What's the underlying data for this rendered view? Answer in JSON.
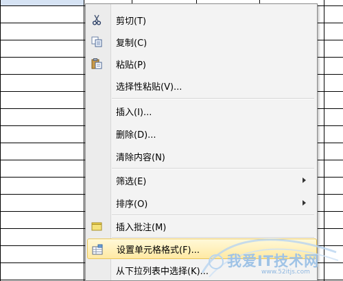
{
  "context_menu": {
    "items": [
      {
        "label": "剪切(T)",
        "icon": "scissors-icon"
      },
      {
        "label": "复制(C)",
        "icon": "copy-icon"
      },
      {
        "label": "粘贴(P)",
        "icon": "paste-icon"
      },
      {
        "label": "选择性粘贴(V)..."
      },
      {
        "label": "插入(I)..."
      },
      {
        "label": "删除(D)..."
      },
      {
        "label": "清除内容(N)"
      },
      {
        "label": "筛选(E)",
        "submenu": true
      },
      {
        "label": "排序(O)",
        "submenu": true
      },
      {
        "label": "插入批注(M)",
        "icon": "comment-icon"
      },
      {
        "label": "设置单元格格式(F)...",
        "icon": "format-cells-icon",
        "highlighted": true
      },
      {
        "label": "从下拉列表中选择(K)..."
      }
    ]
  },
  "watermark": {
    "text": "我爱IT技术网",
    "url": "www.52itjs.com"
  },
  "colors": {
    "menu_bg": "#f3f3f3",
    "highlight": "#ffe9a3",
    "selected_cell": "#d6e3f4"
  }
}
